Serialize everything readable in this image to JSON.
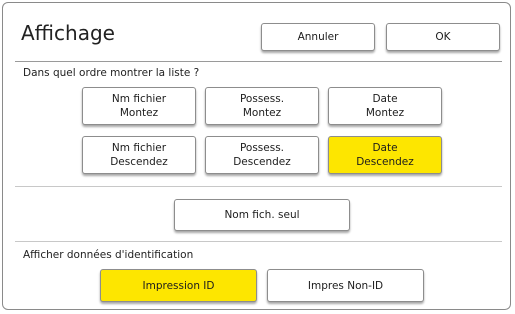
{
  "header": {
    "title": "Affichage",
    "cancel_label": "Annuler",
    "ok_label": "OK"
  },
  "sort": {
    "label": "Dans quel ordre montrer la liste ?",
    "options": [
      {
        "line1": "Nm fichier",
        "line2": "Montez"
      },
      {
        "line1": "Possess.",
        "line2": "Montez"
      },
      {
        "line1": "Date",
        "line2": "Montez"
      },
      {
        "line1": "Nm fichier",
        "line2": "Descendez"
      },
      {
        "line1": "Possess.",
        "line2": "Descendez"
      },
      {
        "line1": "Date",
        "line2": "Descendez"
      }
    ],
    "selected": "Date Descendez",
    "name_only_label": "Nom fich. seul"
  },
  "id_display": {
    "label": "Afficher données d'identification",
    "impression_id_label": "Impression ID",
    "non_id_label": "Impres Non-ID",
    "selected": "Impression ID"
  },
  "colors": {
    "selected_fill": "#fde600",
    "button_fill": "#ffffff"
  }
}
